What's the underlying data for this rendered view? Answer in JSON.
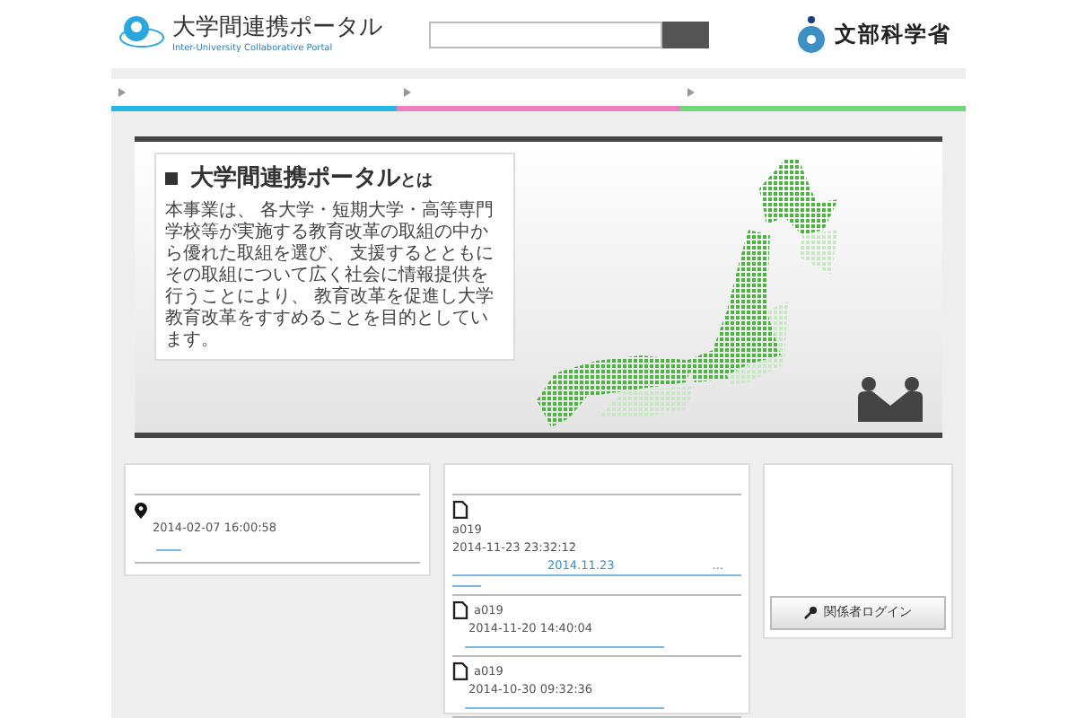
{
  "header": {
    "logo_title": "大学間連携ポータル",
    "logo_subtitle": "Inter-University Collaborative Portal",
    "ministry_name": "文部科学省"
  },
  "nav_tabs": [
    {
      "color": "#29b6e8"
    },
    {
      "color": "#ec7fbf"
    },
    {
      "color": "#6fd67a"
    }
  ],
  "hero": {
    "title": "大学間連携ポータル",
    "title_suffix": "とは",
    "body": "本事業は、 各大学・短期大学・高等専門学校等が実施する教育改革の取組の中から優れた取組を選び、 支援するとともにその取組について広く社会に情報提供を行うことにより、 教育改革を促進し大学教育改革をすすめることを目的としています。"
  },
  "events": [
    {
      "datetime": "2014-02-07 16:00:58"
    }
  ],
  "posts": [
    {
      "author": "a019",
      "datetime": "2014-11-23 23:32:12",
      "link": "2014.11.23",
      "more": "..."
    },
    {
      "author": "a019",
      "datetime": "2014-11-20 14:40:04"
    },
    {
      "author": "a019",
      "datetime": "2014-10-30 09:32:36"
    }
  ],
  "login_button": {
    "label": "関係者ログイン"
  }
}
